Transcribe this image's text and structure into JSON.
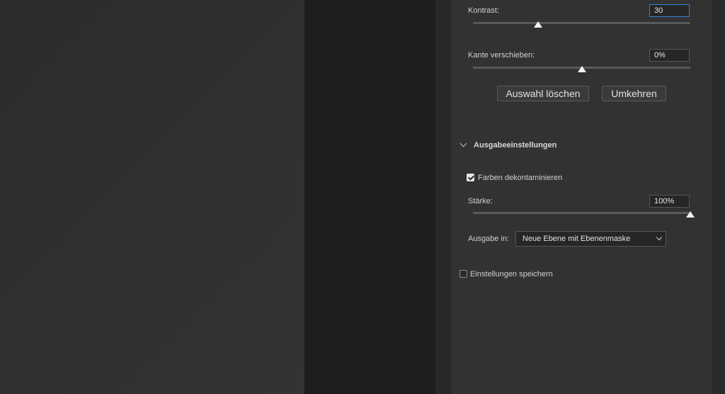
{
  "refine": {
    "contrast": {
      "label": "Kontrast:",
      "value": "30",
      "slider_fraction": 0.3
    },
    "shift_edge": {
      "label": "Kante verschieben:",
      "value": "0%",
      "slider_fraction": 0.5
    },
    "buttons": {
      "clear_selection": "Auswahl löschen",
      "invert": "Umkehren"
    }
  },
  "output": {
    "section_title": "Ausgabeeinstellungen",
    "decontaminate": {
      "label": "Farben dekontaminieren",
      "checked": true
    },
    "strength": {
      "label": "Stärke:",
      "value": "100%",
      "slider_fraction": 1.0
    },
    "output_to": {
      "label": "Ausgabe in:",
      "selected": "Neue Ebene mit Ebenenmaske"
    },
    "remember": {
      "label": "Einstellungen speichern",
      "checked": false
    }
  },
  "colors": {
    "panel_bg": "#323232",
    "canvas_bg": "#2f2f2f",
    "focus": "#3b7bd6",
    "thumb": "#f2f2f2"
  }
}
